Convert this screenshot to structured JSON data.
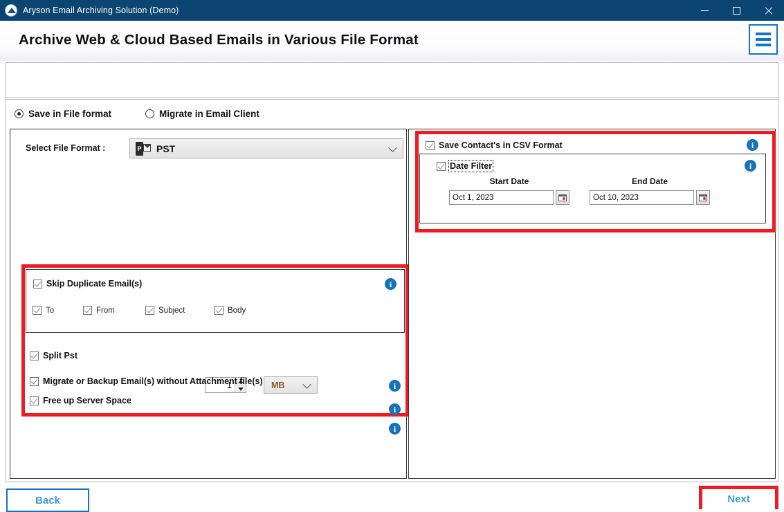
{
  "window": {
    "title": "Aryson Email Archiving Solution (Demo)",
    "logo_icon": "aryson-logo-icon",
    "minimize_glyph": "minimize-icon",
    "maximize_glyph": "maximize-icon",
    "close_glyph": "close-icon",
    "titlebar_color": "#0b4571"
  },
  "header": {
    "title": "Archive Web & Cloud Based Emails in Various File Format",
    "menu_icon": "hamburger-menu-icon",
    "accent_color": "#1474c4"
  },
  "mode": {
    "options": [
      {
        "label": "Save in File format",
        "selected": true
      },
      {
        "label": "Migrate in Email Client",
        "selected": false
      }
    ]
  },
  "left_panel": {
    "file_format": {
      "label": "Select File Format  :",
      "value": "PST",
      "icon": "pst-file-icon",
      "caret_icon": "chevron-down-icon"
    },
    "skip_duplicate": {
      "label": "Skip Duplicate Email(s)",
      "checked": true,
      "info_icon": "info-icon",
      "sub_options": [
        {
          "label": "To",
          "checked": true
        },
        {
          "label": "From",
          "checked": true
        },
        {
          "label": "Subject",
          "checked": true
        },
        {
          "label": "Body",
          "checked": true
        }
      ]
    },
    "split_pst": {
      "label": "Split Pst",
      "checked": true,
      "value": "1",
      "unit": "MB",
      "unit_caret_icon": "chevron-down-icon",
      "spinner_up_icon": "spinner-up-icon",
      "spinner_down_icon": "spinner-down-icon",
      "info_icon": "info-icon"
    },
    "no_attachment": {
      "label": "Migrate or Backup Email(s) without Attachment file(s)",
      "checked": true,
      "info_icon": "info-icon"
    },
    "free_space": {
      "label": "Free up Server Space",
      "checked": true,
      "info_icon": "info-icon"
    }
  },
  "right_panel": {
    "save_contacts": {
      "label": "Save Contact's in CSV Format",
      "checked": true,
      "info_icon": "info-icon"
    },
    "date_filter": {
      "label": "Date Filter",
      "checked": true,
      "info_icon": "info-icon",
      "start": {
        "heading": "Start Date",
        "value": "Oct 1, 2023",
        "calendar_icon": "calendar-icon"
      },
      "end": {
        "heading": "End Date",
        "value": "Oct 10, 2023",
        "calendar_icon": "calendar-icon"
      }
    }
  },
  "footer": {
    "back_label": "Back",
    "next_label": "Next",
    "button_border_color": "#1474c4",
    "button_text_color": "#3a9ae0"
  },
  "highlights": {
    "color": "#ee1c22",
    "regions": [
      "left-options-group",
      "right-contacts-group",
      "next-button"
    ]
  }
}
